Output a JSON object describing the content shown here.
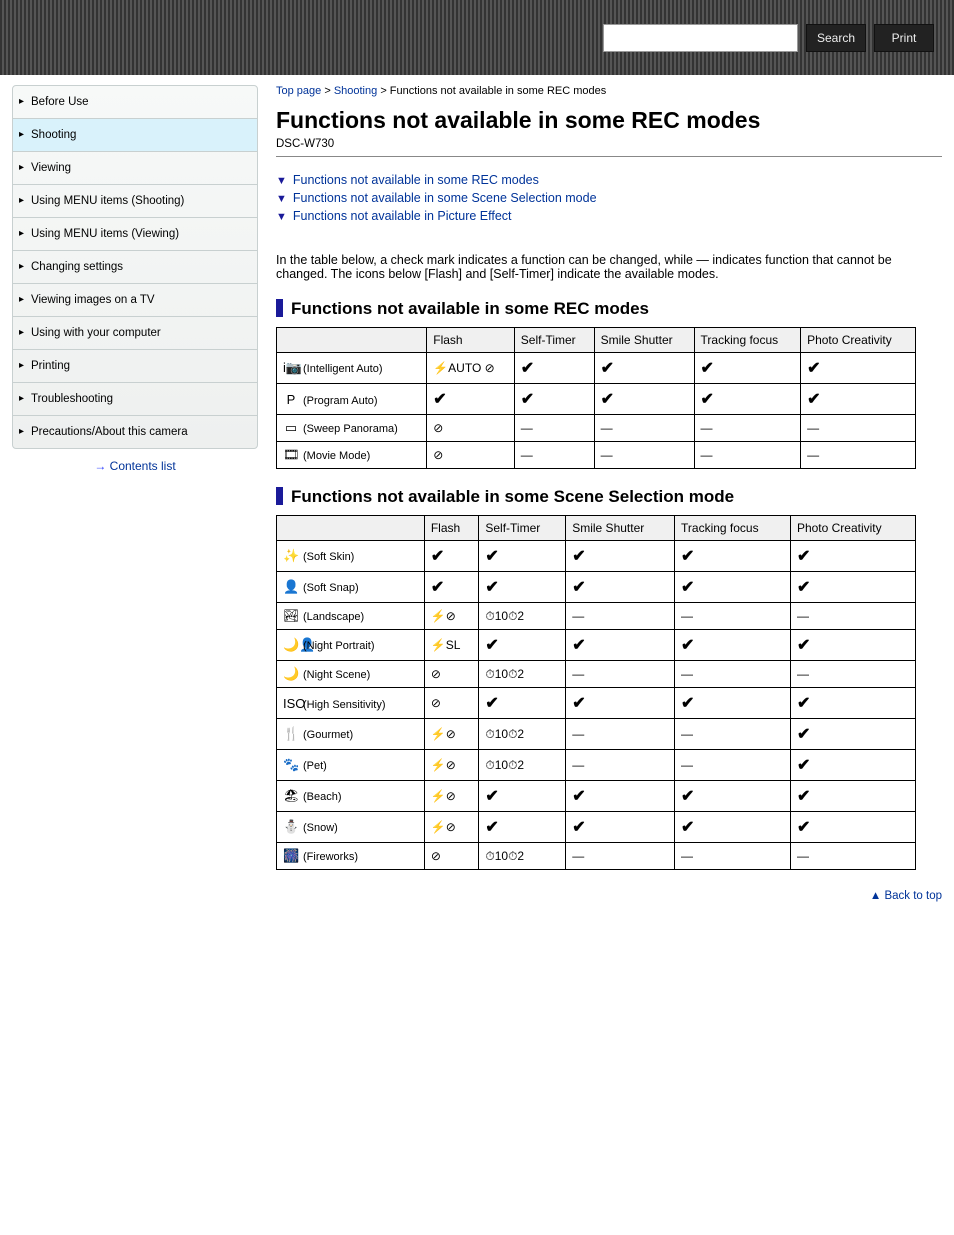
{
  "topbar": {
    "search_placeholder": "",
    "btn_search": "Search",
    "btn_print": "Print"
  },
  "sidebar": {
    "items": [
      "Before Use",
      "Shooting",
      "Viewing",
      "Using MENU items (Shooting)",
      "Using MENU items (Viewing)",
      "Changing settings",
      "Viewing images on a TV",
      "Using with your computer",
      "Printing",
      "Troubleshooting",
      "Precautions/About this camera"
    ],
    "active_index": 1,
    "contents_list": "Contents list"
  },
  "page": {
    "toppage": "Top page",
    "breadcrumb_sep": " > ",
    "breadcrumb_section": "Shooting",
    "breadcrumb_leaf": "Functions not available in some REC modes",
    "title": "Functions not available in some REC modes",
    "product": "DSC-W730"
  },
  "toc": {
    "items": [
      "Functions not available in some REC modes",
      "Functions not available in some Scene Selection mode",
      "Functions not available in Picture Effect"
    ]
  },
  "note": "In the table below, a check mark indicates a function can be changed, while — indicates function that cannot be changed. The icons below [Flash] and [Self-Timer] indicate the available modes.",
  "sections": {
    "a": {
      "heading": "Functions not available in some REC modes",
      "desc": "",
      "headers": [
        "",
        "Flash",
        "Self-Timer",
        "Smile Shutter",
        "Tracking focus",
        "Photo Creativity"
      ],
      "rows": [
        {
          "mode_icon": "i📷",
          "mode_label": "(Intelligent Auto)",
          "flash": "⚡AUTO ⊘",
          "self": "✔",
          "smile": "✔",
          "track": "✔",
          "photo": "✔"
        },
        {
          "mode_icon": "P",
          "mode_label": "(Program Auto)",
          "flash": "✔",
          "self": "✔",
          "smile": "✔",
          "track": "✔",
          "photo": "✔"
        },
        {
          "mode_icon": "▭",
          "mode_label": "(Sweep Panorama)",
          "flash": "⊘",
          "self": "—",
          "smile": "—",
          "track": "—",
          "photo": "—"
        },
        {
          "mode_icon": "🎞",
          "mode_label": "(Movie Mode)",
          "flash": "⊘",
          "self": "—",
          "smile": "—",
          "track": "—",
          "photo": "—"
        }
      ]
    },
    "b": {
      "heading": "Functions not available in some Scene Selection mode",
      "desc": "",
      "headers": [
        "",
        "Flash",
        "Self-Timer",
        "Smile Shutter",
        "Tracking focus",
        "Photo Creativity"
      ],
      "rows": [
        {
          "mode_icon": "✨",
          "mode_label": "(Soft Skin)",
          "flash": "✔",
          "self": "✔",
          "smile": "✔",
          "track": "✔",
          "photo": "✔"
        },
        {
          "mode_icon": "👤",
          "mode_label": "(Soft Snap)",
          "flash": "✔",
          "self": "✔",
          "smile": "✔",
          "track": "✔",
          "photo": "✔"
        },
        {
          "mode_icon": "🏞",
          "mode_label": "(Landscape)",
          "flash": "⚡⊘",
          "self": "⏱10⏱2",
          "smile": "—",
          "track": "—",
          "photo": "—"
        },
        {
          "mode_icon": "🌙👤",
          "mode_label": "(Night Portrait)",
          "flash": "⚡SL",
          "self": "✔",
          "smile": "✔",
          "track": "✔",
          "photo": "✔"
        },
        {
          "mode_icon": "🌙",
          "mode_label": "(Night Scene)",
          "flash": "⊘",
          "self": "⏱10⏱2",
          "smile": "—",
          "track": "—",
          "photo": "—"
        },
        {
          "mode_icon": "ISO",
          "mode_label": "(High Sensitivity)",
          "flash": "⊘",
          "self": "✔",
          "smile": "✔",
          "track": "✔",
          "photo": "✔"
        },
        {
          "mode_icon": "🍴",
          "mode_label": "(Gourmet)",
          "flash": "⚡⊘",
          "self": "⏱10⏱2",
          "smile": "—",
          "track": "—",
          "photo": "✔"
        },
        {
          "mode_icon": "🐾",
          "mode_label": "(Pet)",
          "flash": "⚡⊘",
          "self": "⏱10⏱2",
          "smile": "—",
          "track": "—",
          "photo": "✔"
        },
        {
          "mode_icon": "🏖",
          "mode_label": "(Beach)",
          "flash": "⚡⊘",
          "self": "✔",
          "smile": "✔",
          "track": "✔",
          "photo": "✔"
        },
        {
          "mode_icon": "⛄",
          "mode_label": "(Snow)",
          "flash": "⚡⊘",
          "self": "✔",
          "smile": "✔",
          "track": "✔",
          "photo": "✔"
        },
        {
          "mode_icon": "🎆",
          "mode_label": "(Fireworks)",
          "flash": "⊘",
          "self": "⏱10⏱2",
          "smile": "—",
          "track": "—",
          "photo": "—"
        }
      ]
    }
  },
  "back_to_top": "Back to top"
}
